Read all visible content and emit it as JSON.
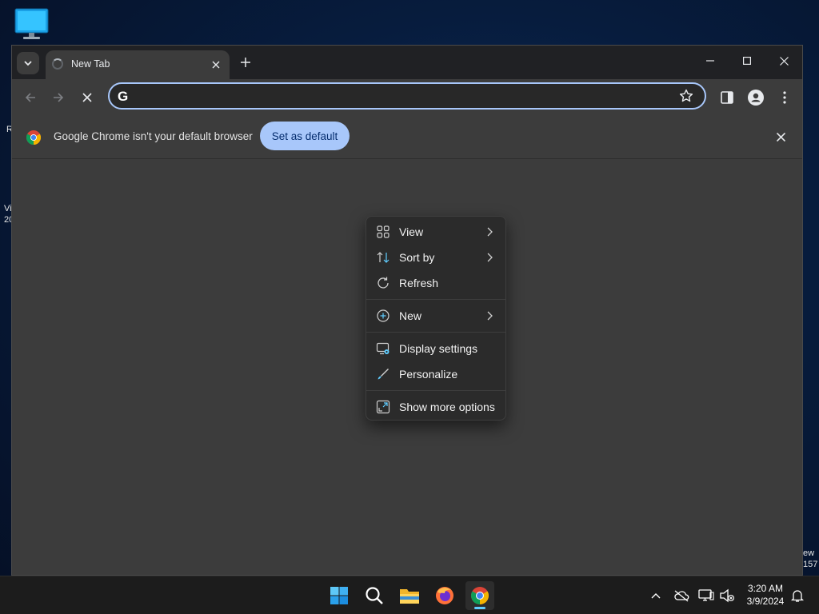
{
  "desktop": {
    "fragments": [
      "R",
      "Vi",
      "20",
      "ew",
      "157"
    ]
  },
  "browser": {
    "tab_title": "New Tab",
    "infobar_message": "Google Chrome isn't your default browser",
    "set_default_label": "Set as default",
    "omnibox_value": "",
    "accent_color": "#a8c7fa"
  },
  "context_menu": {
    "items": [
      {
        "label": "View",
        "icon": "grid-icon",
        "submenu": true
      },
      {
        "label": "Sort by",
        "icon": "sort-icon",
        "submenu": true
      },
      {
        "label": "Refresh",
        "icon": "refresh-icon",
        "submenu": false
      },
      {
        "label": "New",
        "icon": "add-circle-icon",
        "submenu": true
      },
      {
        "label": "Display settings",
        "icon": "display-settings-icon",
        "submenu": false
      },
      {
        "label": "Personalize",
        "icon": "brush-icon",
        "submenu": false
      },
      {
        "label": "Show more options",
        "icon": "expand-icon",
        "submenu": false
      }
    ]
  },
  "taskbar": {
    "apps": [
      "start-icon",
      "search-icon",
      "file-explorer-icon",
      "firefox-icon",
      "chrome-icon"
    ],
    "time": "3:20 AM",
    "date": "3/9/2024"
  }
}
